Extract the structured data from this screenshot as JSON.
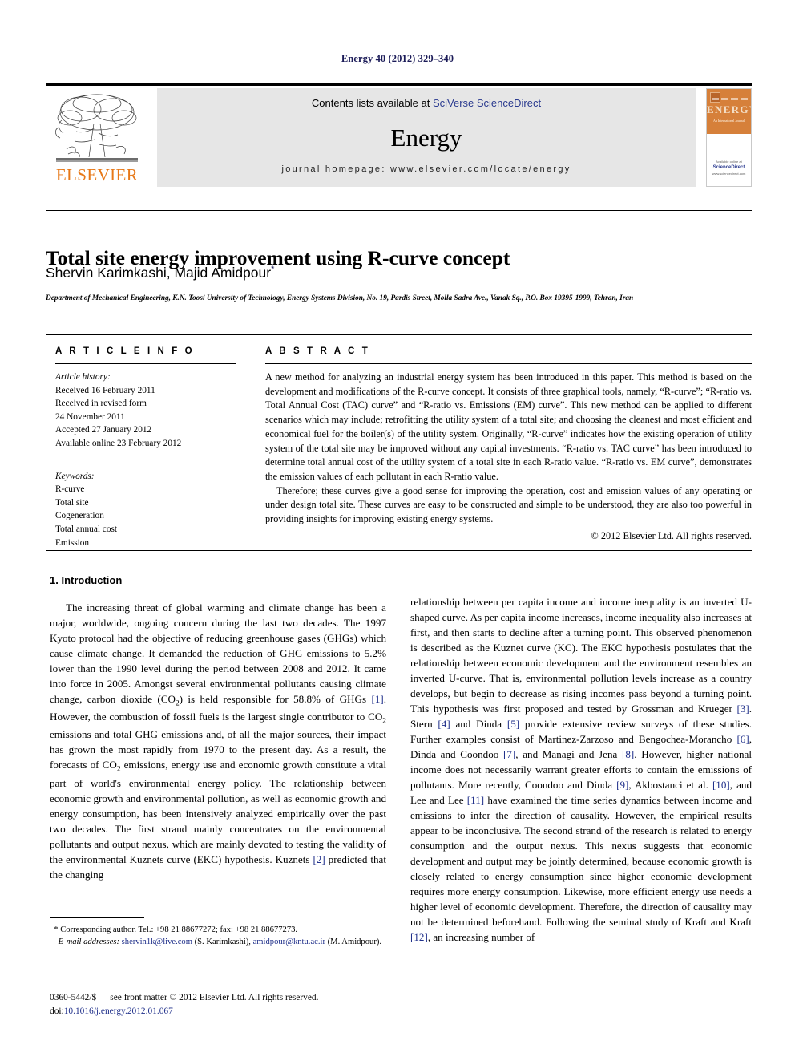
{
  "running_head": "Energy 40 (2012) 329–340",
  "masthead": {
    "contents_prefix": "Contents lists available at ",
    "contents_link": "SciVerse ScienceDirect",
    "journal_title": "Energy",
    "homepage": "journal homepage: www.elsevier.com/locate/energy",
    "publisher_name": "ELSEVIER",
    "cover": {
      "title": "ENERGY",
      "subtitle": "An International Journal",
      "footer_line1": "Available online at",
      "footer_line2": "ScienceDirect",
      "footer_line3": "www.sciencedirect.com"
    }
  },
  "article": {
    "title": "Total site energy improvement using R-curve concept",
    "authors": "Shervin Karimkashi, Majid Amidpour",
    "corresponding_marker": "*",
    "affiliation": "Department of Mechanical Engineering, K.N. Toosi University of Technology, Energy Systems Division, No. 19, Pardis Street, Molla Sadra Ave., Vanak Sq., P.O. Box 19395-1999, Tehran, Iran"
  },
  "article_info": {
    "heading": "A R T I C L E   I N F O",
    "history_label": "Article history:",
    "history": [
      "Received 16 February 2011",
      "Received in revised form",
      "24 November 2011",
      "Accepted 27 January 2012",
      "Available online 23 February 2012"
    ],
    "keywords_label": "Keywords:",
    "keywords": [
      "R-curve",
      "Total site",
      "Cogeneration",
      "Total annual cost",
      "Emission"
    ]
  },
  "abstract": {
    "heading": "A B S T R A C T",
    "paragraph1": "A new method for analyzing an industrial energy system has been introduced in this paper. This method is based on the development and modifications of the R-curve concept. It consists of three graphical tools, namely, “R-curve”; “R-ratio vs. Total Annual Cost (TAC) curve” and “R-ratio vs. Emissions (EM) curve”. This new method can be applied to different scenarios which may include; retrofitting the utility system of a total site; and choosing the cleanest and most efficient and economical fuel for the boiler(s) of the utility system. Originally, “R-curve” indicates how the existing operation of utility system of the total site may be improved without any capital investments. “R-ratio vs. TAC curve” has been introduced to determine total annual cost of the utility system of a total site in each R-ratio value. “R-ratio vs. EM curve”, demonstrates the emission values of each pollutant in each R-ratio value.",
    "paragraph2": "Therefore; these curves give a good sense for improving the operation, cost and emission values of any operating or under design total site. These curves are easy to be constructed and simple to be understood, they are also too powerful in providing insights for improving existing energy systems.",
    "copyright": "© 2012 Elsevier Ltd. All rights reserved."
  },
  "body": {
    "section_number_title": "1.  Introduction",
    "left_paragraph": "The increasing threat of global warming and climate change has been a major, worldwide, ongoing concern during the last two decades. The 1997 Kyoto protocol had the objective of reducing greenhouse gases (GHGs) which cause climate change. It demanded the reduction of GHG emissions to 5.2% lower than the 1990 level during the period between 2008 and 2012. It came into force in 2005. Amongst several environmental pollutants causing climate change, carbon dioxide (CO2) is held responsible for 58.8% of GHGs [1]. However, the combustion of fossil fuels is the largest single contributor to CO2 emissions and total GHG emissions and, of all the major sources, their impact has grown the most rapidly from 1970 to the present day. As a result, the forecasts of CO2 emissions, energy use and economic growth constitute a vital part of world's environmental energy policy. The relationship between economic growth and environmental pollution, as well as economic growth and energy consumption, has been intensively analyzed empirically over the past two decades. The first strand mainly concentrates on the environmental pollutants and output nexus, which are mainly devoted to testing the validity of the environmental Kuznets curve (EKC) hypothesis. Kuznets [2] predicted that the changing",
    "right_paragraph": "relationship between per capita income and income inequality is an inverted U-shaped curve. As per capita income increases, income inequality also increases at first, and then starts to decline after a turning point. This observed phenomenon is described as the Kuznet curve (KC). The EKC hypothesis postulates that the relationship between economic development and the environment resembles an inverted U-curve. That is, environmental pollution levels increase as a country develops, but begin to decrease as rising incomes pass beyond a turning point. This hypothesis was first proposed and tested by Grossman and Krueger [3]. Stern [4] and Dinda [5] provide extensive review surveys of these studies. Further examples consist of Martinez-Zarzoso and Bengochea-Morancho [6], Dinda and Coondoo [7], and Managi and Jena [8]. However, higher national income does not necessarily warrant greater efforts to contain the emissions of pollutants. More recently, Coondoo and Dinda [9], Akbostanci et al. [10], and Lee and Lee [11] have examined the time series dynamics between income and emissions to infer the direction of causality. However, the empirical results appear to be inconclusive. The second strand of the research is related to energy consumption and the output nexus. This nexus suggests that economic development and output may be jointly determined, because economic growth is closely related to energy consumption since higher economic development requires more energy consumption. Likewise, more efficient energy use needs a higher level of economic development. Therefore, the direction of causality may not be determined beforehand. Following the seminal study of Kraft and Kraft [12], an increasing number of"
  },
  "footnotes": {
    "corresponding": "* Corresponding author. Tel.: +98 21 88677272; fax: +98 21 88677273.",
    "email_label": "E-mail addresses:",
    "email1": "shervin1k@live.com",
    "email1_owner": "(S. Karimkashi),",
    "email2": "amidpour@kntu.ac.ir",
    "email2_owner": "(M. Amidpour)."
  },
  "imprint": {
    "line1": "0360-5442/$ — see front matter © 2012 Elsevier Ltd. All rights reserved.",
    "doi_label": "doi:",
    "doi_value": "10.1016/j.energy.2012.01.067"
  },
  "colors": {
    "link": "#1f2f8a",
    "elsevier_orange": "#e77817",
    "band_gray": "#e6e6e6",
    "running_head": "#1b1b58"
  }
}
